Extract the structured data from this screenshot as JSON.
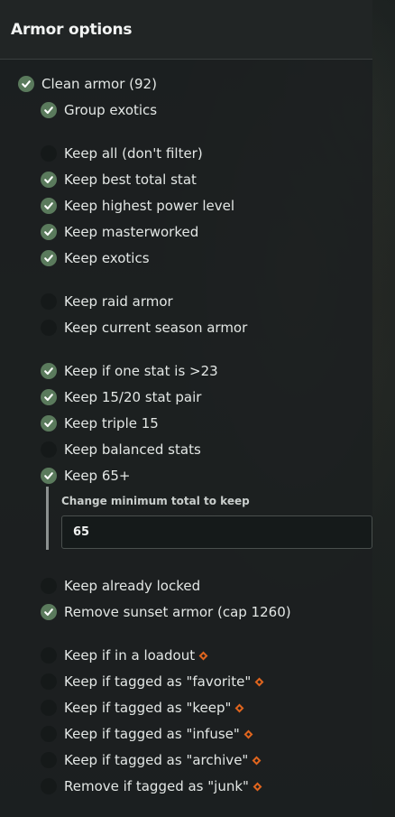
{
  "panel": {
    "title": "Armor options"
  },
  "options": [
    {
      "key": "clean",
      "label": "Clean armor (92)",
      "checked": true,
      "tagged": false
    },
    {
      "key": "group_exotics",
      "label": "Group exotics",
      "checked": true,
      "tagged": false
    },
    {
      "key": "keep_all",
      "label": "Keep all (don't filter)",
      "checked": false,
      "tagged": false
    },
    {
      "key": "keep_best_total",
      "label": "Keep best total stat",
      "checked": true,
      "tagged": false
    },
    {
      "key": "keep_highest_power",
      "label": "Keep highest power level",
      "checked": true,
      "tagged": false
    },
    {
      "key": "keep_masterworked",
      "label": "Keep masterworked",
      "checked": true,
      "tagged": false
    },
    {
      "key": "keep_exotics",
      "label": "Keep exotics",
      "checked": true,
      "tagged": false
    },
    {
      "key": "keep_raid",
      "label": "Keep raid armor",
      "checked": false,
      "tagged": false
    },
    {
      "key": "keep_season",
      "label": "Keep current season armor",
      "checked": false,
      "tagged": false
    },
    {
      "key": "keep_one_stat",
      "label": "Keep if one stat is >23",
      "checked": true,
      "tagged": false
    },
    {
      "key": "keep_pair",
      "label": "Keep 15/20 stat pair",
      "checked": true,
      "tagged": false
    },
    {
      "key": "keep_triple",
      "label": "Keep triple 15",
      "checked": true,
      "tagged": false
    },
    {
      "key": "keep_balanced",
      "label": "Keep balanced stats",
      "checked": false,
      "tagged": false
    },
    {
      "key": "keep_65",
      "label": "Keep 65+",
      "checked": true,
      "tagged": false
    },
    {
      "key": "keep_locked",
      "label": "Keep already locked",
      "checked": false,
      "tagged": false
    },
    {
      "key": "remove_sunset",
      "label": "Remove sunset armor (cap 1260)",
      "checked": true,
      "tagged": false
    },
    {
      "key": "keep_loadout",
      "label": "Keep if in a loadout",
      "checked": false,
      "tagged": true
    },
    {
      "key": "keep_favorite",
      "label": "Keep if tagged as \"favorite\"",
      "checked": false,
      "tagged": true
    },
    {
      "key": "keep_keep",
      "label": "Keep if tagged as \"keep\"",
      "checked": false,
      "tagged": true
    },
    {
      "key": "keep_infuse",
      "label": "Keep if tagged as \"infuse\"",
      "checked": false,
      "tagged": true
    },
    {
      "key": "keep_archive",
      "label": "Keep if tagged as \"archive\"",
      "checked": false,
      "tagged": true
    },
    {
      "key": "remove_junk",
      "label": "Remove if tagged as \"junk\"",
      "checked": false,
      "tagged": true
    }
  ],
  "min_total": {
    "label": "Change minimum total to keep",
    "value": "65"
  },
  "colors": {
    "checked": "#5a7a5c",
    "unchecked": "#151919",
    "tag_diamond": "#e0651e"
  }
}
